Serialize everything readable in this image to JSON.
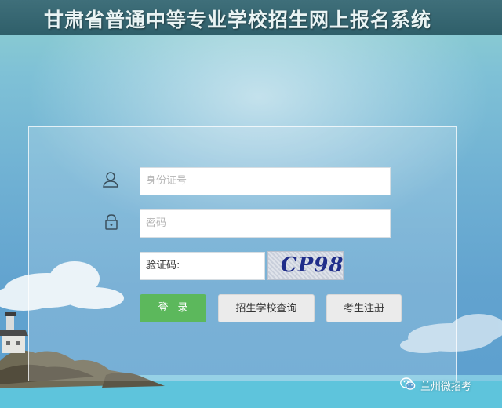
{
  "header": {
    "title": "甘肃省普通中等专业学校招生网上报名系统"
  },
  "form": {
    "id_number": {
      "placeholder": "身份证号",
      "icon": "user-icon"
    },
    "password": {
      "placeholder": "密码",
      "icon": "lock-icon"
    },
    "captcha": {
      "label": "验证码:",
      "image_text": "CP98"
    }
  },
  "buttons": {
    "login": "登录",
    "school_query": "招生学校查询",
    "register": "考生注册"
  },
  "watermark": {
    "text": "兰州微招考",
    "icon": "wechat-icon"
  },
  "colors": {
    "login_button": "#5cb85c",
    "header_bg": "#3f6f7a"
  }
}
